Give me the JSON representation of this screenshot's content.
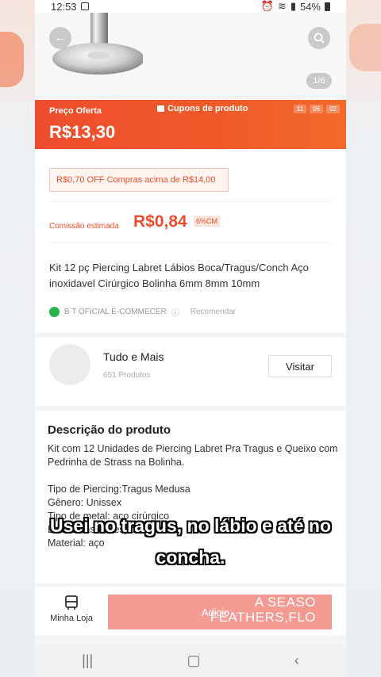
{
  "status_bar": {
    "time": "12:53",
    "battery": "54%"
  },
  "image": {
    "counter": "1/6"
  },
  "offer": {
    "label": "Preço Oferta",
    "price": "R$13,30",
    "coupon_label": "Cupons de produto",
    "timer": [
      "11",
      "06",
      "02"
    ]
  },
  "promo": {
    "text": "R$0,70 OFF Compras acima de R$14,00"
  },
  "commission": {
    "label": "Comissão estimada",
    "value": "R$0,84",
    "percent": "6%CM"
  },
  "product": {
    "title": "Kit 12 pç Piercing Labret Lábios Boca/Tragus/Conch Aço inoxidavel Cirúrgico Bolinha 6mm 8mm 10mm",
    "seller": "B T OFICIAL E-COMMECER",
    "recommend": "Recomendar"
  },
  "shop": {
    "name": "Tudo e Mais",
    "products": "651 Produtos",
    "visit_label": "Visitar"
  },
  "description": {
    "title": "Descrição do produto",
    "intro": "Kit com 12 Unidades de Piercing Labret Pra Tragus e Queixo com Pedrinha de Strass na Bolinha.",
    "lines": [
      "Tipo de Piercing:Tragus Medusa",
      "Gênero: Unissex",
      "Tipo de metal: aço cirúrgico",
      "Estilo: Casual, esporte",
      "Material: aço"
    ]
  },
  "bottom": {
    "store_label": "Minha Loja",
    "add_label": "Adicio...",
    "overlay_line1": "A SEASO",
    "overlay_line2": "FEATHERS,FLO"
  },
  "subtitles": {
    "line1": "Usei no tragus, no lábio e até no",
    "line2": "concha."
  },
  "colors": {
    "accent": "#ee4d2d",
    "seller_dot": "#26b34a"
  }
}
